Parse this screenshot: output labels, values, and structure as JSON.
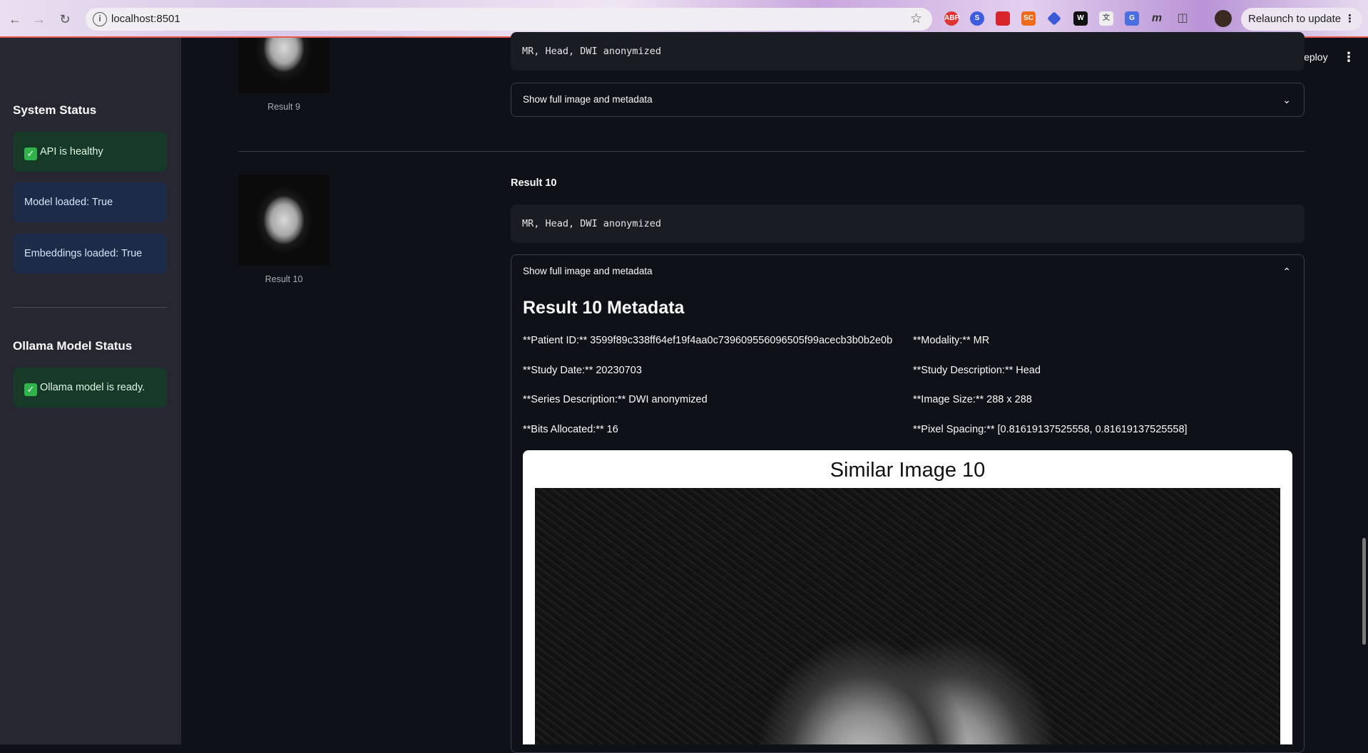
{
  "browser": {
    "url": "localhost:8501",
    "relaunch_label": "Relaunch to update",
    "icons": [
      "back-icon",
      "forward-icon",
      "reload-icon",
      "info-icon",
      "star-icon",
      "extensions-icon",
      "kebab-icon"
    ]
  },
  "sidebar": {
    "system_status_title": "System Status",
    "api_status": "API is healthy",
    "model_loaded": "Model loaded: True",
    "embeddings_loaded": "Embeddings loaded: True",
    "ollama_title": "Ollama Model Status",
    "ollama_status": "Ollama model is ready."
  },
  "header": {
    "deploy_label": "Deploy"
  },
  "results": [
    {
      "caption": "Result 9",
      "summary": "MR, Head, DWI anonymized",
      "expander_label": "Show full image and metadata"
    },
    {
      "title": "Result 10",
      "caption": "Result 10",
      "summary": "MR, Head, DWI anonymized",
      "expander_label": "Show full image and metadata",
      "metadata_title": "Result 10 Metadata",
      "metadata": {
        "patient_id": "**Patient ID:** 3599f89c338ff64ef19f4aa0c739609556096505f99acecb3b0b2e0b",
        "modality": "**Modality:** MR",
        "study_date": "**Study Date:** 20230703",
        "study_description": "**Study Description:** Head",
        "series_description": "**Series Description:** DWI anonymized",
        "image_size": "**Image Size:** 288 x 288",
        "bits_allocated": "**Bits Allocated:** 16",
        "pixel_spacing": "**Pixel Spacing:** [0.81619137525558, 0.81619137525558]"
      },
      "figure_title": "Similar Image 10"
    }
  ],
  "colors": {
    "app_bg": "#0e1117",
    "sidebar_bg": "#262730",
    "success_bg": "#173928",
    "info_bg": "#1c2b47"
  }
}
